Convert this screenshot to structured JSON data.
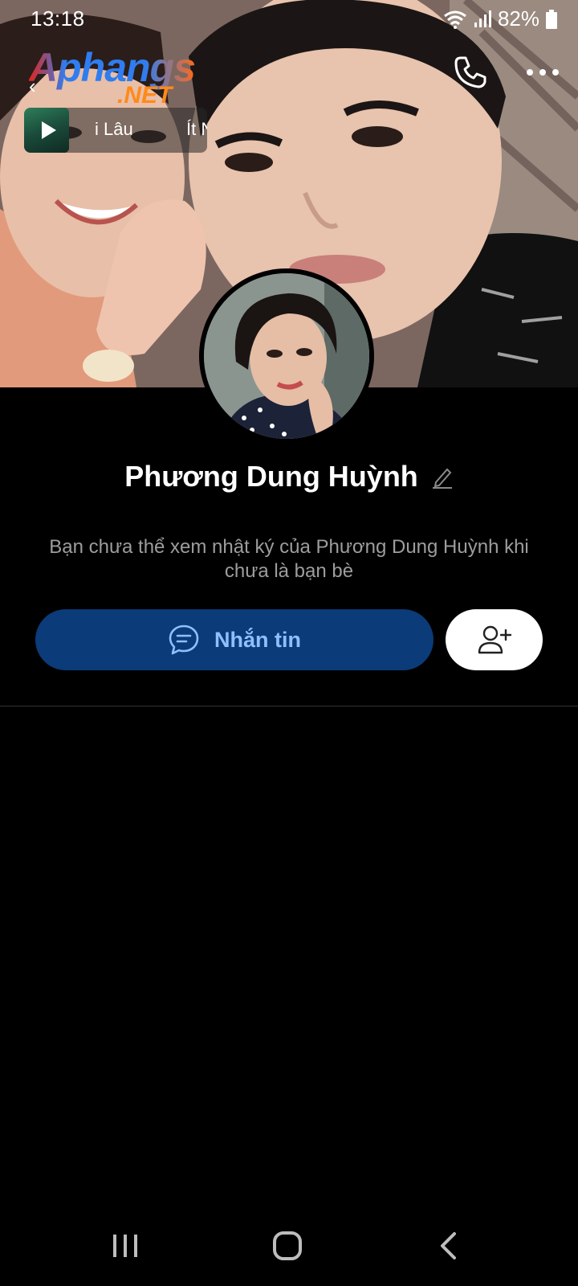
{
  "status_bar": {
    "time": "13:18",
    "battery": "82%",
    "icons": [
      "wifi-icon",
      "signal-icon",
      "battery-icon"
    ]
  },
  "header": {
    "logo_main": "Aphangs",
    "logo_sub": ".NET",
    "back_icon": "back-arrow-icon",
    "call_icon": "phone-icon",
    "more_icon": "more-dots-icon"
  },
  "music": {
    "title_part1": "i Lâu",
    "title_part2": "Ít Nh",
    "play_icon": "play-icon"
  },
  "profile": {
    "name": "Phương Dung Huỳnh",
    "edit_icon": "pencil-icon",
    "notice": "Bạn chưa thể xem nhật ký của Phương Dung Huỳnh khi chưa là bạn bè"
  },
  "actions": {
    "message_label": "Nhắn tin",
    "message_icon": "chat-bubble-icon",
    "add_friend_icon": "add-friend-icon"
  },
  "colors": {
    "message_button_bg": "#0b3b78",
    "message_button_text": "#8ec0ff",
    "background": "#000000",
    "notice_text": "#9d9d9d"
  },
  "nav": {
    "recents_icon": "recents-icon",
    "home_icon": "home-icon",
    "back_icon": "nav-back-icon"
  }
}
